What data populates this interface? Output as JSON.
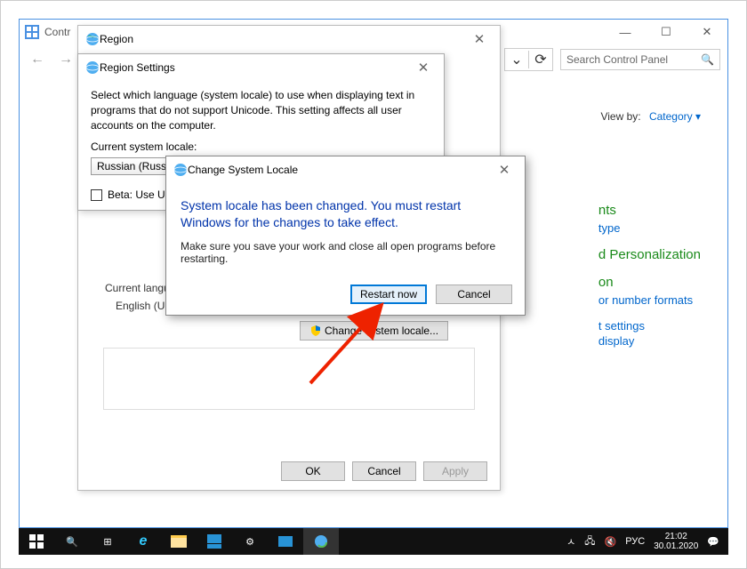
{
  "cp": {
    "title": "Contr",
    "search_placeholder": "Search Control Panel",
    "viewby_label": "View by:",
    "viewby_value": "Category ▾",
    "links": {
      "g1": "nts",
      "l1": "type",
      "g2": "d Personalization",
      "g3": "on",
      "l3": "or number formats",
      "l4": "t settings",
      "l5": "display"
    }
  },
  "region": {
    "title": "Region",
    "cur_lang_label": "Current language for n",
    "cur_lang_value": "English (United Stat",
    "change_btn": "Change system locale...",
    "ok": "OK",
    "cancel": "Cancel",
    "apply": "Apply"
  },
  "settings": {
    "title": "Region Settings",
    "desc": "Select which language (system locale) to use when displaying text in programs that do not support Unicode. This setting affects all user accounts on the computer.",
    "label": "Current system locale:",
    "value": "Russian (Russia)",
    "beta": "Beta: Use Unicode UTF-"
  },
  "confirm": {
    "title": "Change System Locale",
    "msg": "System locale has been changed. You must restart Windows for the changes to take effect.",
    "sub": "Make sure you save your work and close all open programs before restarting.",
    "restart": "Restart now",
    "cancel": "Cancel"
  },
  "taskbar": {
    "lang": "РУС",
    "time": "21:02",
    "date": "30.01.2020"
  }
}
